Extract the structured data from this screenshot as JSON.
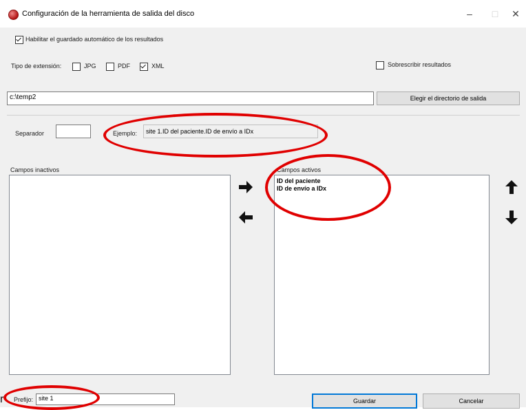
{
  "window": {
    "title": "Configuración de la herramienta de salida del disco",
    "minimize": "–",
    "maximize": "□",
    "close": "✕"
  },
  "autosave": {
    "label": "Habilitar el guardado automático de los resultados",
    "checked": true
  },
  "extension": {
    "label": "Tipo de extensión:",
    "options": [
      {
        "label": "JPG",
        "checked": false
      },
      {
        "label": "PDF",
        "checked": false
      },
      {
        "label": "XML",
        "checked": true
      }
    ]
  },
  "overwrite": {
    "label": "Sobrescribir resultados",
    "checked": false
  },
  "output_dir": {
    "value": "c:\\temp2",
    "button_label": "Elegir el directorio de salida"
  },
  "separator": {
    "label": "Separador",
    "value": ""
  },
  "example": {
    "label": "Ejemplo:",
    "value": "site 1.ID del paciente.ID de envío a IDx"
  },
  "inactive_fields": {
    "label": "Campos inactivos",
    "items": []
  },
  "active_fields": {
    "label": "Campos activos",
    "items": [
      "ID del paciente",
      "ID de envío a IDx"
    ]
  },
  "prefix": {
    "label": "Prefijo:",
    "value": "site 1"
  },
  "buttons": {
    "save": "Guardar",
    "cancel": "Cancelar"
  },
  "icons": {
    "move_right": "arrow-right-icon",
    "move_left": "arrow-left-icon",
    "move_up": "arrow-up-icon",
    "move_down": "arrow-down-icon"
  },
  "colors": {
    "highlight": "#e00000",
    "default_button_border": "#0078d7"
  }
}
